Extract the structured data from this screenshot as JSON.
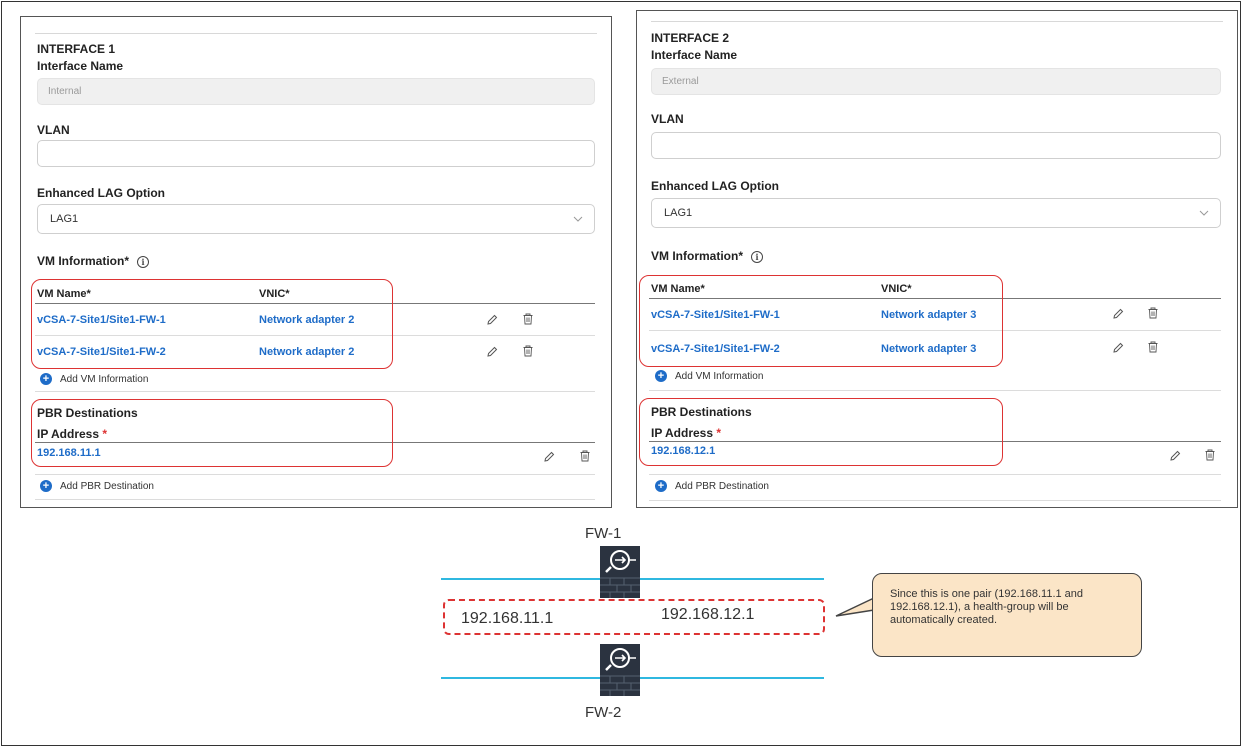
{
  "interface1": {
    "heading": "INTERFACE 1",
    "name_label": "Interface Name",
    "name_value": "Internal",
    "vlan_label": "VLAN",
    "vlan_value": "",
    "lag_label": "Enhanced LAG Option",
    "lag_value": "LAG1",
    "vm_info_label": "VM Information*",
    "col_vm": "VM Name*",
    "col_vnic": "VNIC*",
    "rows": [
      {
        "vm": "vCSA-7-Site1/Site1-FW-1",
        "vnic": "Network adapter 2"
      },
      {
        "vm": "vCSA-7-Site1/Site1-FW-2",
        "vnic": "Network adapter 2"
      }
    ],
    "add_vm": "Add VM Information",
    "pbr_label": "PBR Destinations",
    "ip_label": "IP Address",
    "req": "*",
    "ip_value": "192.168.11.1",
    "add_pbr": "Add PBR Destination"
  },
  "interface2": {
    "heading": "INTERFACE 2",
    "name_label": "Interface Name",
    "name_value": "External",
    "vlan_label": "VLAN",
    "vlan_value": "",
    "lag_label": "Enhanced LAG Option",
    "lag_value": "LAG1",
    "vm_info_label": "VM Information*",
    "col_vm": "VM Name*",
    "col_vnic": "VNIC*",
    "rows": [
      {
        "vm": "vCSA-7-Site1/Site1-FW-1",
        "vnic": "Network adapter 3"
      },
      {
        "vm": "vCSA-7-Site1/Site1-FW-2",
        "vnic": "Network adapter 3"
      }
    ],
    "add_vm": "Add VM Information",
    "pbr_label": "PBR Destinations",
    "ip_label": "IP Address",
    "req": "*",
    "ip_value": "192.168.12.1",
    "add_pbr": "Add PBR Destination"
  },
  "diagram": {
    "fw1": "FW-1",
    "fw2": "FW-2",
    "ip_left": "192.168.11.1",
    "ip_right": "192.168.12.1",
    "callout": "Since this is one pair (192.168.11.1 and 192.168.12.1), a health-group will be automatically created."
  },
  "colors": {
    "link": "#1e6cc8",
    "highlight": "#d33333",
    "network_line": "#2fb8e0",
    "callout_bg": "#fbe5c7"
  },
  "icons": [
    "info-icon",
    "chevron-down-icon",
    "pencil-icon",
    "trash-icon",
    "plus-circle-icon",
    "firewall-icon"
  ]
}
